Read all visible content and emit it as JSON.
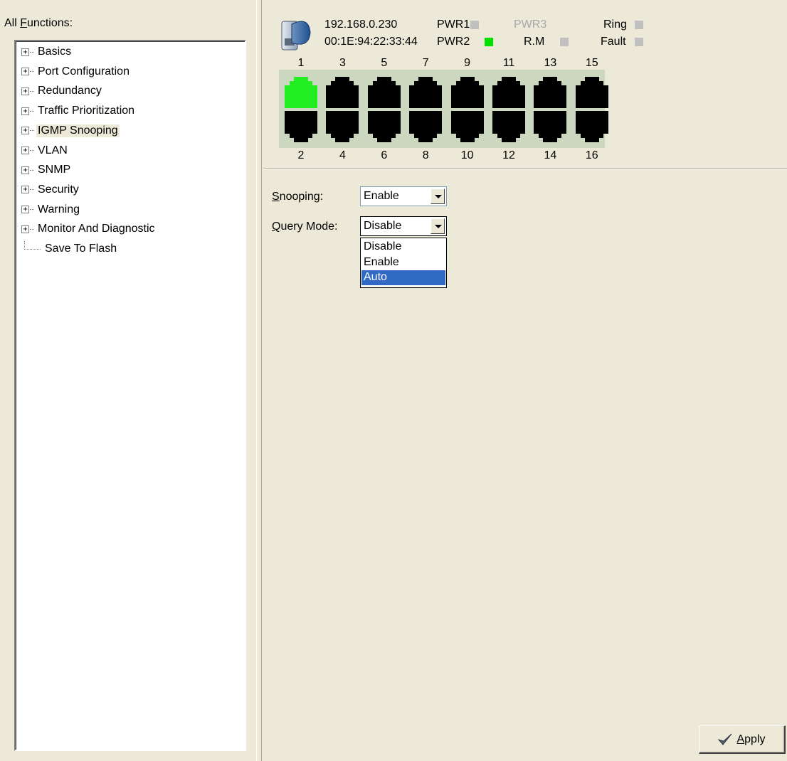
{
  "left": {
    "label_prefix": "All ",
    "label_accel": "F",
    "label_rest": "unctions:",
    "tree": [
      {
        "label": "Basics",
        "expandable": true
      },
      {
        "label": "Port Configuration",
        "expandable": true
      },
      {
        "label": "Redundancy",
        "expandable": true
      },
      {
        "label": "Traffic Prioritization",
        "expandable": true
      },
      {
        "label": "IGMP Snooping",
        "expandable": true,
        "selected": true
      },
      {
        "label": "VLAN",
        "expandable": true
      },
      {
        "label": "SNMP",
        "expandable": true
      },
      {
        "label": "Security",
        "expandable": true
      },
      {
        "label": "Warning",
        "expandable": true
      },
      {
        "label": "Monitor And Diagnostic",
        "expandable": true
      },
      {
        "label": "Save To Flash",
        "expandable": false
      }
    ],
    "expander_symbol": "+"
  },
  "device": {
    "ip": "192.168.0.230",
    "mac": "00:1E:94:22:33:44",
    "indicators": {
      "pwr1": {
        "label": "PWR1",
        "color": "#c0c0c0"
      },
      "pwr2": {
        "label": "PWR2",
        "color": "#00e000"
      },
      "pwr3": {
        "label": "PWR3",
        "color": "#c0c0c0"
      },
      "rm": {
        "label": "R.M",
        "color": "#c0c0c0"
      },
      "ring": {
        "label": "Ring",
        "color": "#c0c0c0"
      },
      "fault": {
        "label": "Fault",
        "color": "#c0c0c0"
      }
    },
    "ports_top": [
      "1",
      "3",
      "5",
      "7",
      "9",
      "11",
      "13",
      "15"
    ],
    "ports_bottom": [
      "2",
      "4",
      "6",
      "8",
      "10",
      "12",
      "14",
      "16"
    ],
    "port_active_color": "#22ee22",
    "port_inactive_color": "#000000",
    "active_ports": [
      "1"
    ]
  },
  "form": {
    "snooping": {
      "label_accel": "S",
      "label_rest": "nooping:",
      "value": "Enable"
    },
    "query_mode": {
      "label_accel": "Q",
      "label_rest": "uery Mode:",
      "value": "Disable",
      "options": [
        "Disable",
        "Enable",
        "Auto"
      ],
      "highlighted": "Auto"
    }
  },
  "apply": {
    "accel": "A",
    "rest": "pply",
    "icon": "checkmark-icon"
  }
}
